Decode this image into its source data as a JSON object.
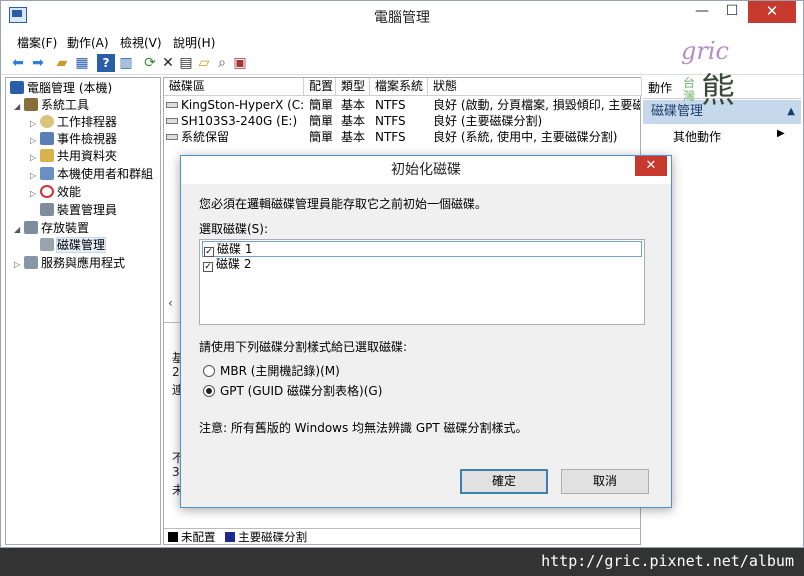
{
  "window": {
    "title": "電腦管理",
    "minimize": "—",
    "maximize": "☐",
    "close": "✕"
  },
  "menu": [
    "檔案(F)",
    "動作(A)",
    "檢視(V)",
    "說明(H)"
  ],
  "toolbar_icons": [
    "back-arrow-icon",
    "forward-arrow-icon",
    "folder-up-icon",
    "show-hide-tree-icon",
    "help-icon",
    "show-hide-action-icon",
    "refresh-icon",
    "delete-icon",
    "properties-icon",
    "open-folder-icon",
    "search-disk-icon",
    "export-icon"
  ],
  "tree": {
    "root": "電腦管理 (本機)",
    "items": [
      {
        "label": "系統工具",
        "level": 1,
        "expanded": true
      },
      {
        "label": "工作排程器",
        "level": 2
      },
      {
        "label": "事件檢視器",
        "level": 2
      },
      {
        "label": "共用資料夾",
        "level": 2
      },
      {
        "label": "本機使用者和群組",
        "level": 2
      },
      {
        "label": "效能",
        "level": 2
      },
      {
        "label": "裝置管理員",
        "level": 2
      },
      {
        "label": "存放裝置",
        "level": 1,
        "expanded": true
      },
      {
        "label": "磁碟管理",
        "level": 2,
        "selected": true
      },
      {
        "label": "服務與應用程式",
        "level": 1
      }
    ]
  },
  "volumes": {
    "headers": [
      "磁碟區",
      "配置",
      "類型",
      "檔案系統",
      "狀態"
    ],
    "rows": [
      [
        "KingSton-HyperX (C:)",
        "簡單",
        "基本",
        "NTFS",
        "良好 (啟動, 分頁檔案, 損毀傾印, 主要磁"
      ],
      [
        "SH103S3-240G (E:)",
        "簡單",
        "基本",
        "NTFS",
        "良好 (主要磁碟分割)"
      ],
      [
        "系統保留",
        "簡單",
        "基本",
        "NTFS",
        "良好 (系統, 使用中, 主要磁碟分割)"
      ]
    ]
  },
  "lower_fragments": [
    "基",
    "2.",
    "連",
    "不",
    "3",
    "未"
  ],
  "legend": {
    "unallocated": "未配置",
    "primary": "主要磁碟分割",
    "colors": {
      "unallocated": "#000000",
      "primary": "#1c2a8c"
    }
  },
  "actions": {
    "header": "動作",
    "section": "磁碟管理",
    "more": "其他動作"
  },
  "watermark": {
    "en": "gric",
    "tw": "台灣",
    "bear": "熊"
  },
  "dialog": {
    "title": "初始化磁碟",
    "intro": "您必須在邏輯磁碟管理員能存取它之前初始一個磁碟。",
    "select_label": "選取磁碟(S):",
    "disks": [
      {
        "label": "磁碟 1",
        "checked": true
      },
      {
        "label": "磁碟 2",
        "checked": true
      }
    ],
    "style_label": "請使用下列磁碟分割樣式給已選取磁碟:",
    "options": [
      {
        "label": "MBR (主開機記錄)(M)",
        "selected": false
      },
      {
        "label": "GPT (GUID 磁碟分割表格)(G)",
        "selected": true
      }
    ],
    "note": "注意: 所有舊版的 Windows 均無法辨識 GPT 磁碟分割樣式。",
    "ok": "確定",
    "cancel": "取消",
    "close": "✕"
  },
  "footer": {
    "url": "http://gric.pixnet.net/album"
  }
}
